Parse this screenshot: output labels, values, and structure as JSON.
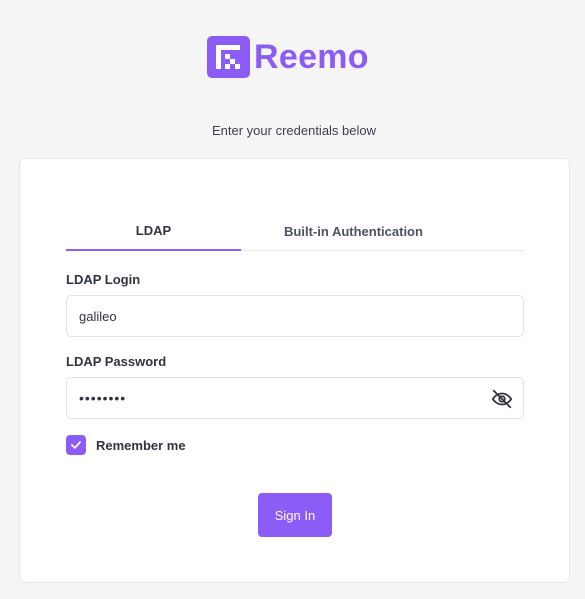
{
  "brand": {
    "name": "Reemo",
    "accent_color": "#8b5cf6",
    "logo_icon": "reemo-logo-icon"
  },
  "subtitle": "Enter your credentials below",
  "tabs": [
    {
      "label": "LDAP",
      "active": true
    },
    {
      "label": "Built-in Authentication",
      "active": false
    }
  ],
  "form": {
    "login_label": "LDAP Login",
    "login_value": "galileo",
    "password_label": "LDAP Password",
    "password_masked": "••••••••",
    "password_visibility_icon": "eye-off-icon",
    "remember_label": "Remember me",
    "remember_checked": true,
    "submit_label": "Sign In"
  }
}
